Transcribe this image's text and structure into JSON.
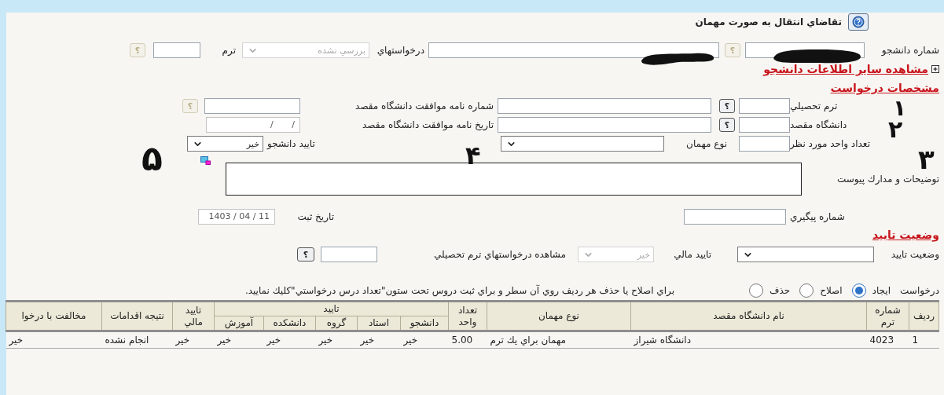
{
  "header": {
    "title": "تقاضاي انتقال به صورت مهمان"
  },
  "student_row": [
    {
      "kind": "label",
      "text": "شماره دانشجو"
    },
    {
      "kind": "input",
      "disabled": false
    },
    {
      "kind": "help",
      "text": "؟",
      "disabled": true
    },
    {
      "kind": "input",
      "disabled": false
    },
    {
      "kind": "label",
      "text": "درخواستهاي"
    },
    {
      "kind": "select",
      "value": "بررسي نشده",
      "disabled": true
    },
    {
      "kind": "label",
      "text": "ترم"
    },
    {
      "kind": "input",
      "disabled": false
    },
    {
      "kind": "help",
      "text": "؟",
      "disabled": true
    }
  ],
  "more_link": {
    "text": "مشاهده سایر اطلاعات دانشجو",
    "expanded": false
  },
  "request_section": {
    "heading": "مشخصات درخواست",
    "term_row": [
      {
        "kind": "label",
        "text": "ترم تحصيلي"
      },
      {
        "kind": "input",
        "disabled": false
      },
      {
        "kind": "help",
        "text": "؟",
        "disabled": false
      },
      {
        "kind": "input",
        "disabled": false
      },
      {
        "kind": "label",
        "text": "شماره نامه موافقت دانشگاه مقصد"
      },
      {
        "kind": "input",
        "disabled": false
      },
      {
        "kind": "help",
        "text": "؟",
        "disabled": true
      }
    ],
    "university_row": [
      {
        "kind": "label",
        "text": "دانشگاه مقصد"
      },
      {
        "kind": "input",
        "disabled": false
      },
      {
        "kind": "help",
        "text": "؟",
        "disabled": false
      },
      {
        "kind": "input",
        "disabled": false
      },
      {
        "kind": "label",
        "text": "تاريخ نامه موافقت دانشگاه مقصد"
      },
      {
        "kind": "input",
        "value": "/ /",
        "disabled": true
      }
    ],
    "units_row": [
      {
        "kind": "label",
        "text": "تعداد واحد مورد نظر"
      },
      {
        "kind": "input",
        "disabled": false
      },
      {
        "kind": "label",
        "text": "نوع مهمان"
      },
      {
        "kind": "select",
        "disabled": false
      },
      {
        "kind": "label",
        "text": "تاييد دانشجو"
      },
      {
        "kind": "select",
        "value": "خير",
        "disabled": false
      }
    ],
    "notes_label": "توضيحات و مدارك پيوست",
    "tracking_row": [
      {
        "kind": "label",
        "text": "شماره پيگيري"
      },
      {
        "kind": "input",
        "disabled": false
      },
      {
        "kind": "label",
        "text": "تاريخ ثبت"
      },
      {
        "kind": "input",
        "value": "1403 / 04 / 11",
        "disabled": true
      }
    ]
  },
  "approval_section": {
    "heading": "وضعيت تاييد",
    "row": [
      {
        "kind": "label",
        "text": "وضعيت تاييد"
      },
      {
        "kind": "select",
        "disabled": false
      },
      {
        "kind": "label",
        "text": "تاييد مالي"
      },
      {
        "kind": "select",
        "value": "خير",
        "disabled": true
      },
      {
        "kind": "label",
        "text": "مشاهده درخواستهاي ترم تحصيلي"
      },
      {
        "kind": "input",
        "disabled": false
      },
      {
        "kind": "help",
        "text": "؟",
        "disabled": false
      }
    ]
  },
  "request_type": {
    "label": "درخواست",
    "options": [
      {
        "label": "ايجاد",
        "selected": true
      },
      {
        "label": "اصلاح",
        "selected": false
      },
      {
        "label": "حذف",
        "selected": false
      }
    ],
    "hint": "براي اصلاح يا حذف هر رديف روي آن سطر و براي ثبت دروس تحت ستون\"تعداد درس درخواستي\"كليك نماييد."
  },
  "table": {
    "group_header": "تاييد",
    "columns": [
      {
        "label": "رديف"
      },
      {
        "label": "شماره ترم"
      },
      {
        "label": "نام دانشگاه مقصد"
      },
      {
        "label": "نوع مهمان"
      },
      {
        "label": "تعداد واحد"
      },
      {
        "label": "دانشجو"
      },
      {
        "label": "استاد"
      },
      {
        "label": "گروه"
      },
      {
        "label": "دانشكده"
      },
      {
        "label": "آموزش"
      },
      {
        "label": "تاييد مالي"
      },
      {
        "label": "نتيجه اقدامات"
      },
      {
        "label": "مخالفت با درخوا"
      }
    ],
    "rows": [
      [
        "1",
        "4023",
        "دانشگاه شيراز",
        "مهمان براي يك ترم",
        "5.00",
        "خير",
        "خير",
        "خير",
        "خير",
        "خير",
        "خير",
        "انجام نشده",
        "خير"
      ]
    ]
  },
  "annotations": [
    "۱",
    "۲",
    "۳",
    "۴",
    "۵"
  ]
}
